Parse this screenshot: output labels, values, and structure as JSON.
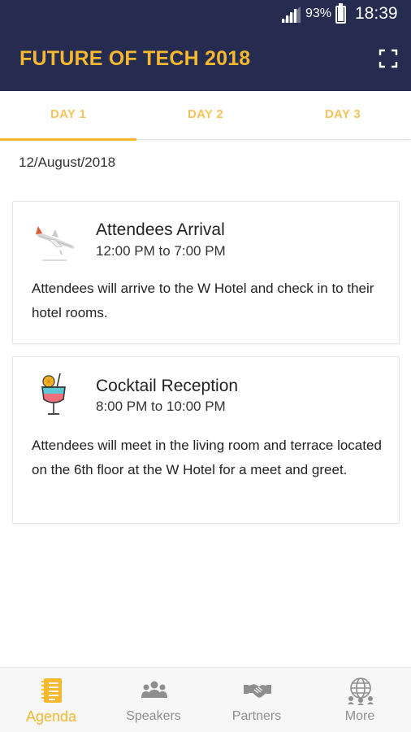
{
  "status_bar": {
    "battery_percent": "93%",
    "time": "18:39",
    "signal_icon": "signal-icon",
    "battery_icon": "battery-icon"
  },
  "app_bar": {
    "title": "FUTURE OF TECH 2018",
    "fullscreen_icon": "fullscreen-icon",
    "background_color": "#262b50",
    "accent_color": "#f5b82e"
  },
  "tabs": [
    {
      "label": "DAY 1",
      "selected": true
    },
    {
      "label": "DAY 2",
      "selected": false
    },
    {
      "label": "DAY 3",
      "selected": false
    }
  ],
  "date": "12/August/2018",
  "events": [
    {
      "icon": "airplane-icon",
      "title": "Attendees Arrival",
      "time": "12:00 PM to 7:00 PM",
      "description": "Attendees will arrive to the W Hotel and check in to their hotel rooms."
    },
    {
      "icon": "cocktail-icon",
      "title": "Cocktail Reception",
      "time": "8:00 PM to 10:00 PM",
      "description": "Attendees will meet in the living room and terrace located on the 6th floor at the W Hotel for a meet and greet."
    }
  ],
  "bottom_nav": [
    {
      "label": "Agenda",
      "icon": "agenda-icon",
      "active": true
    },
    {
      "label": "Speakers",
      "icon": "speakers-icon",
      "active": false
    },
    {
      "label": "Partners",
      "icon": "partners-icon",
      "active": false
    },
    {
      "label": "More",
      "icon": "globe-icon",
      "active": false
    }
  ]
}
